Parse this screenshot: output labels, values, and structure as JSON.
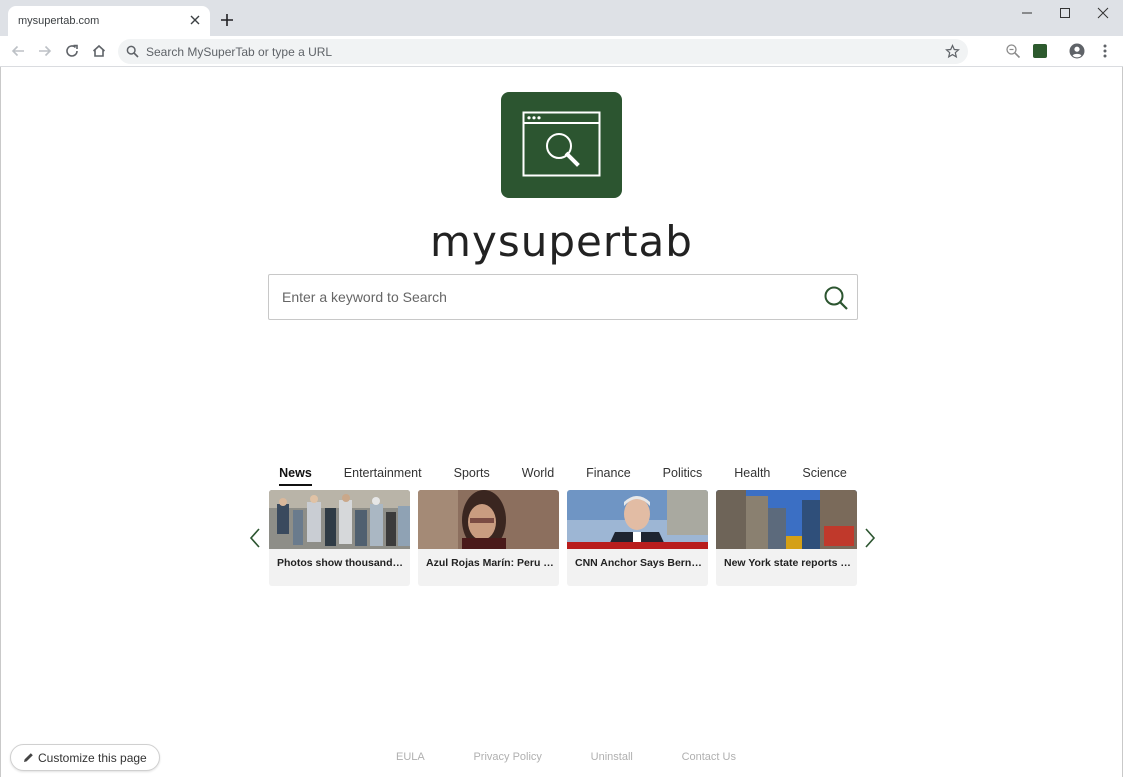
{
  "browser": {
    "tab_title": "mysupertab.com",
    "omnibox_placeholder": "Search MySuperTab or type a URL"
  },
  "brand": {
    "name": "mysupertab",
    "logo_color": "#2c5530"
  },
  "search": {
    "placeholder": "Enter a keyword to Search"
  },
  "news": {
    "tabs": [
      {
        "label": "News",
        "active": true
      },
      {
        "label": "Entertainment"
      },
      {
        "label": "Sports"
      },
      {
        "label": "World"
      },
      {
        "label": "Finance"
      },
      {
        "label": "Politics"
      },
      {
        "label": "Health"
      },
      {
        "label": "Science"
      }
    ],
    "cards": [
      {
        "title": "Photos show thousands p..."
      },
      {
        "title": "Azul Rojas Marín: Peru fo..."
      },
      {
        "title": "CNN Anchor Says Bernie '..."
      },
      {
        "title": "New York state reports m..."
      }
    ]
  },
  "customize": {
    "label": "Customize this page"
  },
  "footer": {
    "links": [
      "EULA",
      "Privacy Policy",
      "Uninstall",
      "Contact Us"
    ]
  }
}
